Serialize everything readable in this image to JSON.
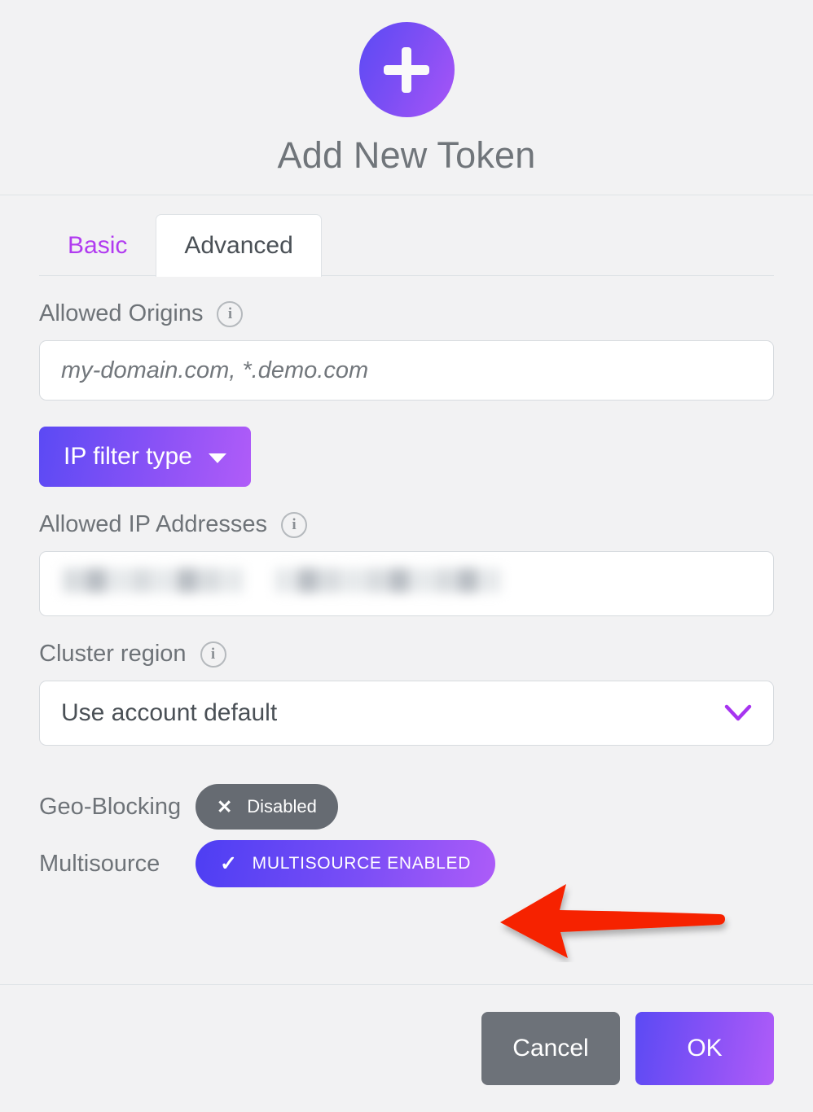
{
  "dialog": {
    "title": "Add New Token",
    "add_icon": "plus-icon"
  },
  "tabs": [
    {
      "label": "Basic",
      "active": false
    },
    {
      "label": "Advanced",
      "active": true
    }
  ],
  "fields": {
    "allowed_origins": {
      "label": "Allowed Origins",
      "info_icon": "info-icon",
      "placeholder": "my-domain.com, *.demo.com",
      "value": ""
    },
    "ip_filter_type": {
      "label": "IP filter type",
      "caret_icon": "chevron-down-icon"
    },
    "allowed_ip_addresses": {
      "label": "Allowed IP Addresses",
      "info_icon": "info-icon",
      "value": "",
      "redacted": true
    },
    "cluster_region": {
      "label": "Cluster region",
      "info_icon": "info-icon",
      "selected": "Use account default",
      "chevron_icon": "chevron-down-icon"
    }
  },
  "toggles": [
    {
      "label": "Geo-Blocking",
      "state_label": "Disabled",
      "state_icon": "x-icon",
      "enabled": false
    },
    {
      "label": "Multisource",
      "state_label": "MULTISOURCE ENABLED",
      "state_icon": "check-icon",
      "enabled": true
    }
  ],
  "annotation": {
    "arrow": "red-arrow-pointing-left",
    "color": "#f62400"
  },
  "footer": {
    "cancel_label": "Cancel",
    "ok_label": "OK"
  },
  "colors": {
    "background": "#f2f2f3",
    "accent_start": "#5b4af4",
    "accent_end": "#b05cf8",
    "tab_inactive": "#b13bf0",
    "neutral_pill": "#666b72",
    "text_muted": "#6e7378"
  }
}
